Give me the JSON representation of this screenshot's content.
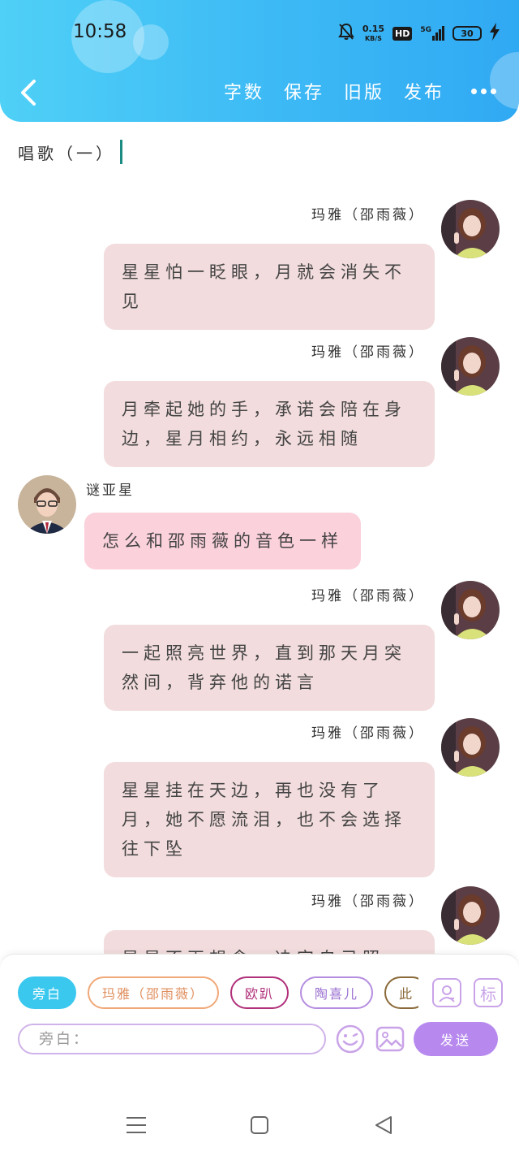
{
  "status_bar": {
    "time": "10:58",
    "net_speed_value": "0.15",
    "net_speed_unit": "KB/S",
    "hd_label": "HD",
    "network_label": "5G",
    "battery_level": "30"
  },
  "nav": {
    "actions": [
      "字数",
      "保存",
      "旧版",
      "发布"
    ]
  },
  "chapter_title": "唱歌（一）",
  "messages": [
    {
      "side": "right",
      "speaker": "玛雅（邵雨薇）",
      "text": "星星怕一眨眼，月就会消失不见"
    },
    {
      "side": "right",
      "speaker": "玛雅（邵雨薇）",
      "text": "月牵起她的手，承诺会陪在身边，星月相约，永远相随"
    },
    {
      "side": "left",
      "speaker": "谜亚星",
      "text": "怎么和邵雨薇的音色一样"
    },
    {
      "side": "right",
      "speaker": "玛雅（邵雨薇）",
      "text": "一起照亮世界，直到那天月突然间，背弃他的诺言"
    },
    {
      "side": "right",
      "speaker": "玛雅（邵雨薇）",
      "text": "星星挂在天边，再也没有了月，她不愿流泪，也不会选择往下坠"
    },
    {
      "side": "right",
      "speaker": "玛雅（邵雨薇）",
      "text": "星星不再想念，决定自己照"
    }
  ],
  "roles": [
    {
      "label": "旁白",
      "color": "#3bc8ef",
      "active": true
    },
    {
      "label": "玛雅（邵雨薇）",
      "color": "#f0a878",
      "active": false
    },
    {
      "label": "欧趴",
      "color": "#b0307a",
      "active": false
    },
    {
      "label": "陶喜儿",
      "color": "#b58de0",
      "active": false
    },
    {
      "label": "此",
      "color": "#8a6a3a",
      "active": false
    }
  ],
  "panel": {
    "mark_button_label": "标",
    "input_placeholder": "旁白：",
    "send_label": "发送"
  },
  "colors": {
    "header_gradient_start": "#4fd0f6",
    "header_gradient_end": "#30a9f3",
    "bubble_right": "#f2dcdd",
    "bubble_left": "#fbd1dc",
    "accent_purple": "#b789ee",
    "caret": "#1c8b82"
  },
  "icons": {
    "back": "chevron-left-icon",
    "more": "more-horizontal-icon",
    "character": "person-card-icon",
    "emoji": "smiley-icon",
    "image": "image-icon",
    "mute": "bell-off-icon"
  }
}
